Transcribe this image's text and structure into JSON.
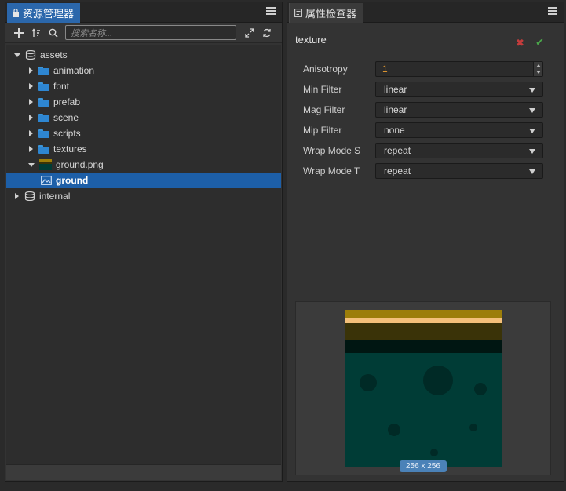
{
  "left_panel": {
    "tab_label": "资源管理器",
    "search_placeholder": "搜索名称...",
    "tree": [
      {
        "label": "assets",
        "icon": "database-icon",
        "level": 0,
        "expanded": true
      },
      {
        "label": "animation",
        "icon": "folder-icon",
        "level": 1,
        "expanded": false
      },
      {
        "label": "font",
        "icon": "folder-icon",
        "level": 1,
        "expanded": false
      },
      {
        "label": "prefab",
        "icon": "folder-icon",
        "level": 1,
        "expanded": false
      },
      {
        "label": "scene",
        "icon": "folder-icon",
        "level": 1,
        "expanded": false
      },
      {
        "label": "scripts",
        "icon": "folder-icon",
        "level": 1,
        "expanded": false
      },
      {
        "label": "textures",
        "icon": "folder-icon",
        "level": 1,
        "expanded": false
      },
      {
        "label": "ground.png",
        "icon": "image-thumbnail-icon",
        "level": 1,
        "expanded": true
      },
      {
        "label": "ground",
        "icon": "sprite-frame-icon",
        "level": 2,
        "selected": true
      },
      {
        "label": "internal",
        "icon": "database-icon",
        "level": 0,
        "expanded": false
      }
    ]
  },
  "right_panel": {
    "tab_label": "属性检查器",
    "asset_title": "texture",
    "properties": [
      {
        "label": "Anisotropy",
        "type": "number",
        "value": "1"
      },
      {
        "label": "Min Filter",
        "type": "select",
        "value": "linear"
      },
      {
        "label": "Mag Filter",
        "type": "select",
        "value": "linear"
      },
      {
        "label": "Mip Filter",
        "type": "select",
        "value": "none"
      },
      {
        "label": "Wrap Mode S",
        "type": "select",
        "value": "repeat"
      },
      {
        "label": "Wrap Mode T",
        "type": "select",
        "value": "repeat"
      }
    ],
    "preview_size": "256 x 256"
  },
  "colors": {
    "accent_tab": "#2b67ab",
    "selection": "#1d5fa8",
    "folder": "#2e86d1",
    "number_value": "#f0a030",
    "cancel": "#c43c3c",
    "confirm": "#4aa64a"
  }
}
